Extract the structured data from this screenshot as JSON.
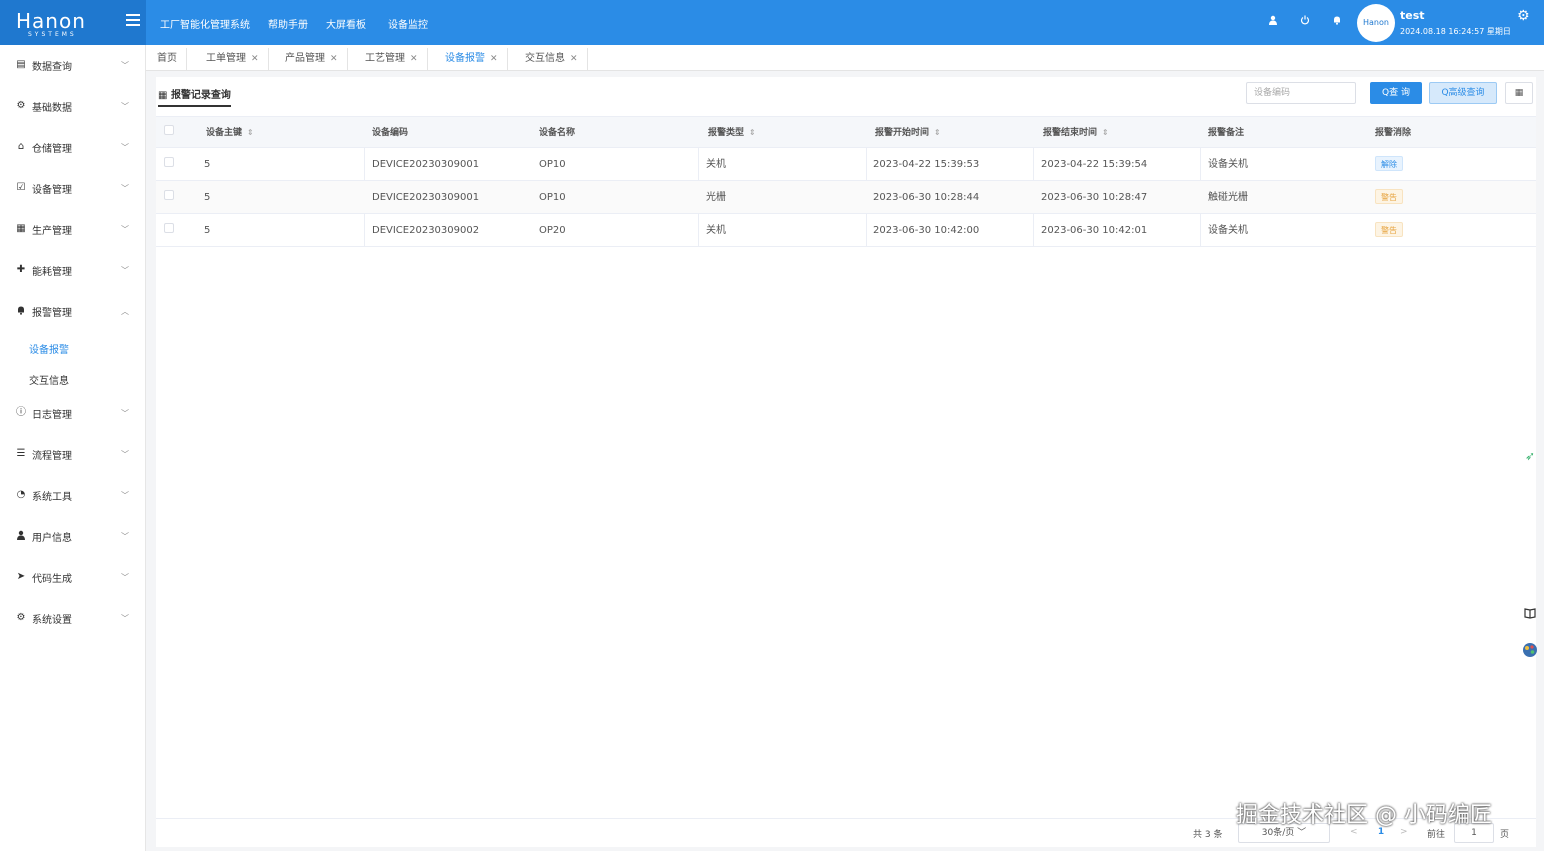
{
  "brand": {
    "logo": "Hanon",
    "logo_sub": "SYSTEMS"
  },
  "topnav": {
    "items": [
      "工厂智能化管理系统",
      "帮助手册",
      "大屏看板",
      "设备监控"
    ]
  },
  "user": {
    "avatar_text": "Hanon",
    "name": "test",
    "datetime": "2024.08.18 16:24:57 星期日"
  },
  "sidebar": {
    "items": [
      {
        "label": "数据查询",
        "icon": "document-icon",
        "glyph": "▤"
      },
      {
        "label": "基础数据",
        "icon": "gear-icon",
        "glyph": "⚙"
      },
      {
        "label": "仓储管理",
        "icon": "home-icon",
        "glyph": "⌂"
      },
      {
        "label": "设备管理",
        "icon": "checkbox-icon",
        "glyph": "☑"
      },
      {
        "label": "生产管理",
        "icon": "grid-icon",
        "glyph": "▦"
      },
      {
        "label": "能耗管理",
        "icon": "plus-circle-icon",
        "glyph": "✚"
      },
      {
        "label": "报警管理",
        "icon": "bell-icon",
        "glyph": "🔔"
      },
      {
        "label": "日志管理",
        "icon": "info-icon",
        "glyph": "ⓘ"
      },
      {
        "label": "流程管理",
        "icon": "sliders-icon",
        "glyph": "☰"
      },
      {
        "label": "系统工具",
        "icon": "dashboard-icon",
        "glyph": "◔"
      },
      {
        "label": "用户信息",
        "icon": "user-icon",
        "glyph": "👤"
      },
      {
        "label": "代码生成",
        "icon": "send-icon",
        "glyph": "➤"
      },
      {
        "label": "系统设置",
        "icon": "settings-icon",
        "glyph": "⚙"
      }
    ],
    "sub_items": [
      "设备报警",
      "交互信息"
    ]
  },
  "tabs": [
    {
      "label": "首页",
      "closable": false
    },
    {
      "label": "工单管理",
      "closable": true
    },
    {
      "label": "产品管理",
      "closable": true
    },
    {
      "label": "工艺管理",
      "closable": true
    },
    {
      "label": "设备报警",
      "closable": true
    },
    {
      "label": "交互信息",
      "closable": true
    }
  ],
  "panel": {
    "title": "报警记录查询",
    "search_placeholder": "设备编码",
    "query_label": "Q查 询",
    "advanced_label": "Q高级查询",
    "grid_label": "▦"
  },
  "table": {
    "columns": [
      "设备主键",
      "设备编码",
      "设备名称",
      "报警类型",
      "报警开始时间",
      "报警结束时间",
      "报警备注",
      "报警消除"
    ],
    "rows": [
      {
        "id": "5",
        "code": "DEVICE20230309001",
        "name": "OP10",
        "type": "关机",
        "start": "2023-04-22 15:39:53",
        "end": "2023-04-22 15:39:54",
        "remark": "设备关机",
        "status": "解除",
        "status_color": "#2b8ce6"
      },
      {
        "id": "5",
        "code": "DEVICE20230309001",
        "name": "OP10",
        "type": "光栅",
        "start": "2023-06-30 10:28:44",
        "end": "2023-06-30 10:28:47",
        "remark": "触碰光栅",
        "status": "警告",
        "status_color": "#e6a23c"
      },
      {
        "id": "5",
        "code": "DEVICE20230309002",
        "name": "OP20",
        "type": "关机",
        "start": "2023-06-30 10:42:00",
        "end": "2023-06-30 10:42:01",
        "remark": "设备关机",
        "status": "警告",
        "status_color": "#e6a23c"
      }
    ]
  },
  "pager": {
    "total": "共 3 条",
    "page_size": "30条/页",
    "prev": "<",
    "current": "1",
    "next": ">",
    "goto": "前往",
    "goto_value": "1",
    "page_suffix": "页"
  },
  "watermark": "掘金技术社区 @ 小码编匠"
}
